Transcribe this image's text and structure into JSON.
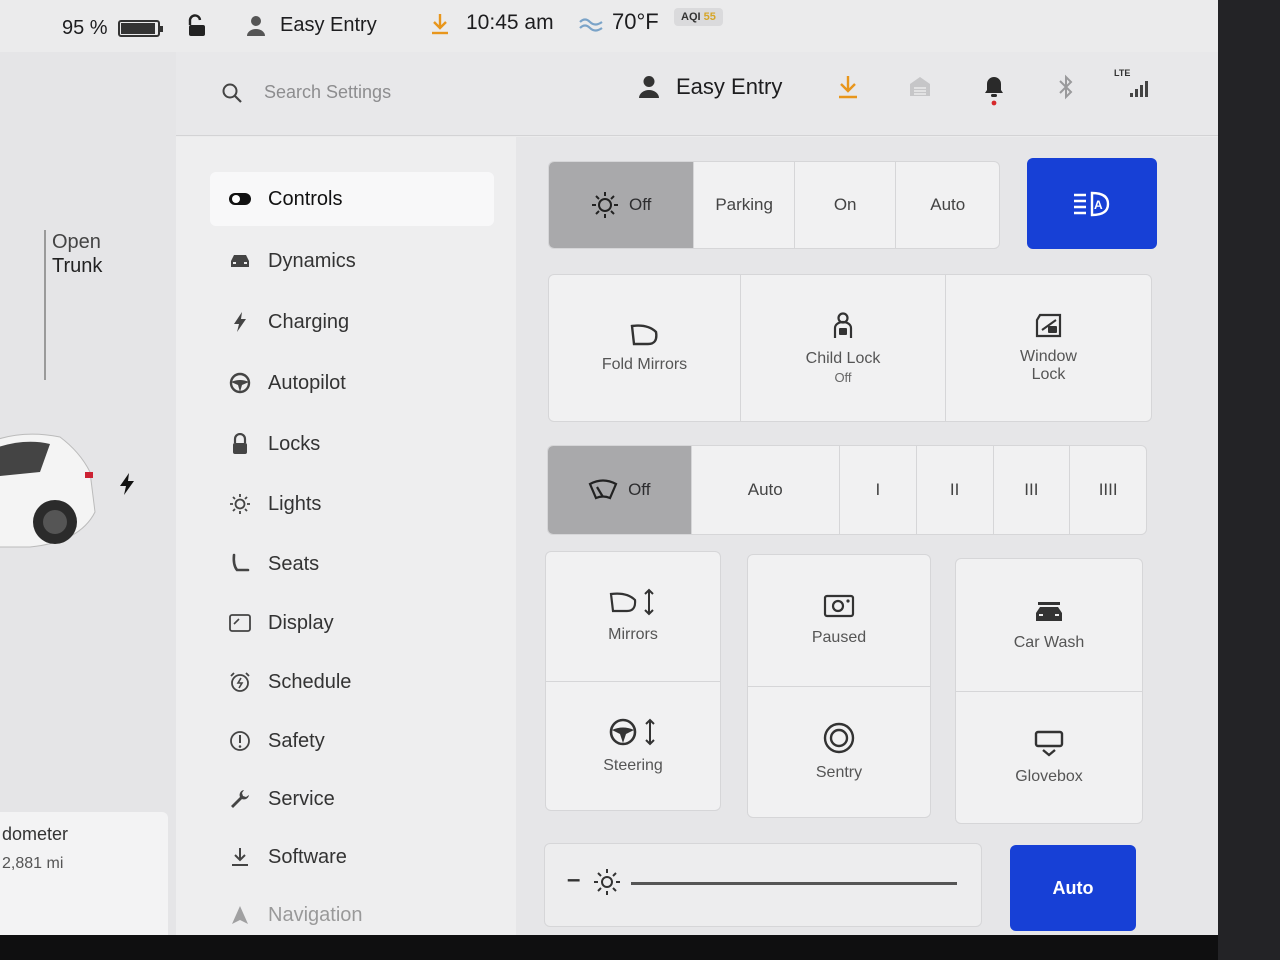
{
  "status": {
    "battery_percent": "95 %",
    "battery_level": 0.95,
    "profile": "Easy Entry",
    "time": "10:45 am",
    "temperature": "70°F",
    "aqi_label": "AQI",
    "aqi_value": "55"
  },
  "car": {
    "trunk_line1": "Open",
    "trunk_line2": "Trunk",
    "odometer_label": "dometer",
    "odometer_value": "2,881 mi"
  },
  "header": {
    "search_placeholder": "Search Settings",
    "profile_name": "Easy Entry",
    "network_label": "LTE"
  },
  "sidebar": {
    "items": [
      {
        "label": "Controls",
        "icon": "toggle-icon"
      },
      {
        "label": "Dynamics",
        "icon": "car-icon"
      },
      {
        "label": "Charging",
        "icon": "bolt-icon"
      },
      {
        "label": "Autopilot",
        "icon": "steering-wheel-icon"
      },
      {
        "label": "Locks",
        "icon": "lock-icon"
      },
      {
        "label": "Lights",
        "icon": "sun-icon"
      },
      {
        "label": "Seats",
        "icon": "seat-icon"
      },
      {
        "label": "Display",
        "icon": "display-icon"
      },
      {
        "label": "Schedule",
        "icon": "alarm-clock-icon"
      },
      {
        "label": "Safety",
        "icon": "exclamation-circle-icon"
      },
      {
        "label": "Service",
        "icon": "wrench-icon"
      },
      {
        "label": "Software",
        "icon": "download-icon"
      },
      {
        "label": "Navigation",
        "icon": "navigation-arrow-icon"
      }
    ]
  },
  "lights": {
    "options": [
      "Off",
      "Parking",
      "On",
      "Auto"
    ],
    "selected": "Off"
  },
  "tiles": {
    "fold_mirrors": "Fold Mirrors",
    "child_lock": "Child Lock",
    "child_lock_state": "Off",
    "window_lock": "Window Lock"
  },
  "wipers": {
    "options": [
      "Off",
      "Auto",
      "I",
      "II",
      "III",
      "IIII"
    ],
    "selected": "Off"
  },
  "grid": {
    "mirrors": "Mirrors",
    "steering": "Steering",
    "dashcam": "Paused",
    "sentry": "Sentry",
    "car_wash": "Car Wash",
    "glovebox": "Glovebox"
  },
  "brightness": {
    "minus": "–",
    "level": 1.0,
    "auto_label": "Auto"
  },
  "colors": {
    "accent_blue": "#1740d6",
    "selected_gray": "#a9a9ab",
    "download_orange": "#e8961c",
    "alert_red": "#d6282b"
  }
}
